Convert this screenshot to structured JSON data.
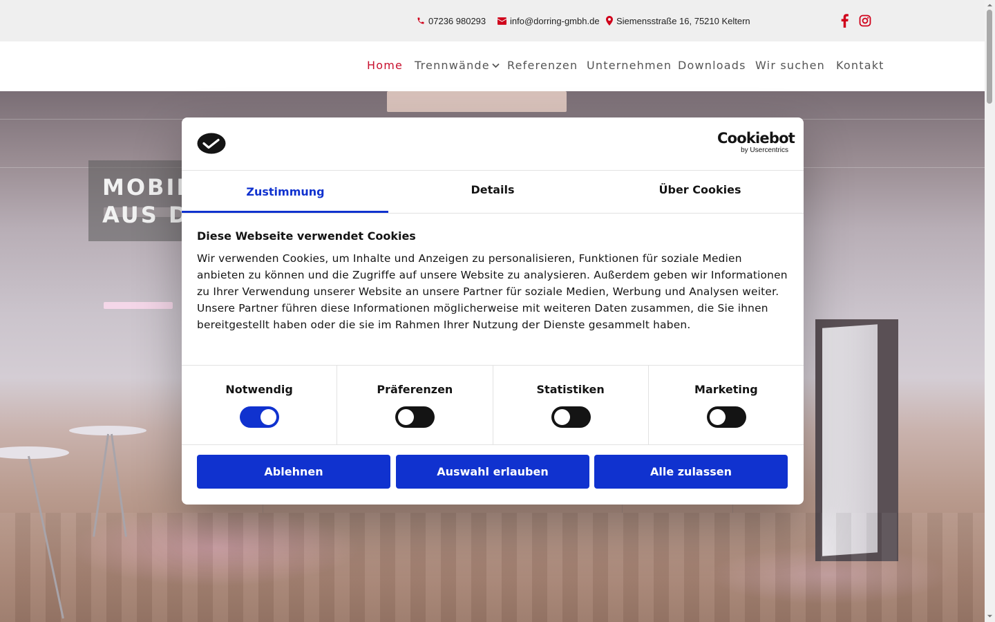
{
  "topbar": {
    "phone": "07236 980293",
    "email": "info@dorring-gmbh.de",
    "address": "Siemensstraße 16, 75210 Keltern",
    "icons": [
      "phone-icon",
      "envelope-icon",
      "map-marker-icon",
      "facebook-icon",
      "instagram-icon"
    ],
    "accent_color": "#d0021b"
  },
  "nav": {
    "items": [
      {
        "label": "Home",
        "active": true
      },
      {
        "label": "Trennwände",
        "has_dropdown": true
      },
      {
        "label": "Referenzen"
      },
      {
        "label": "Unternehmen"
      },
      {
        "label": "Downloads"
      },
      {
        "label": "Wir suchen"
      },
      {
        "label": "Kontakt"
      }
    ],
    "active_color": "#c8102e"
  },
  "hero": {
    "title_line1": "MOBIL",
    "title_line2": "AUS D"
  },
  "cookie_dialog": {
    "logo_main": "Cookiebot",
    "logo_sub": "by Usercentrics",
    "tabs": [
      {
        "label": "Zustimmung",
        "active": true
      },
      {
        "label": "Details"
      },
      {
        "label": "Über Cookies"
      }
    ],
    "title": "Diese Webseite verwendet Cookies",
    "body": "Wir verwenden Cookies, um Inhalte und Anzeigen zu personalisieren, Funktionen für soziale Medien anbieten zu können und die Zugriffe auf unsere Website zu analysieren. Außerdem geben wir Informationen zu Ihrer Verwendung unserer Website an unsere Partner für soziale Medien, Werbung und Analysen weiter. Unsere Partner führen diese Informationen möglicherweise mit weiteren Daten zusammen, die Sie ihnen bereitgestellt haben oder die sie im Rahmen Ihrer Nutzung der Dienste gesammelt haben.",
    "categories": [
      {
        "label": "Notwendig",
        "enabled": true
      },
      {
        "label": "Präferenzen",
        "enabled": false
      },
      {
        "label": "Statistiken",
        "enabled": false
      },
      {
        "label": "Marketing",
        "enabled": false
      }
    ],
    "buttons": {
      "decline": "Ablehnen",
      "allow_selection": "Auswahl erlauben",
      "allow_all": "Alle zulassen"
    },
    "accent_color": "#1032cf"
  }
}
